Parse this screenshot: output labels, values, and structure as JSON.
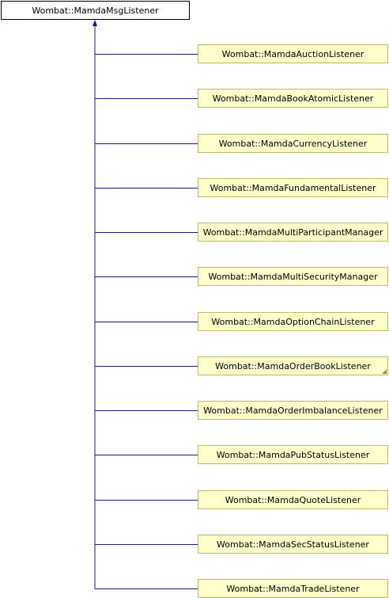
{
  "diagram": {
    "base_class": {
      "label": "Wombat::MamdaMsgListener"
    },
    "derived_classes": [
      {
        "label": "Wombat::MamdaAuctionListener",
        "has_more": false
      },
      {
        "label": "Wombat::MamdaBookAtomicListener",
        "has_more": false
      },
      {
        "label": "Wombat::MamdaCurrencyListener",
        "has_more": false
      },
      {
        "label": "Wombat::MamdaFundamentalListener",
        "has_more": false
      },
      {
        "label": "Wombat::MamdaMultiParticipantManager",
        "has_more": false
      },
      {
        "label": "Wombat::MamdaMultiSecurityManager",
        "has_more": false
      },
      {
        "label": "Wombat::MamdaOptionChainListener",
        "has_more": false
      },
      {
        "label": "Wombat::MamdaOrderBookListener",
        "has_more": true
      },
      {
        "label": "Wombat::MamdaOrderImbalanceListener",
        "has_more": false
      },
      {
        "label": "Wombat::MamdaPubStatusListener",
        "has_more": false
      },
      {
        "label": "Wombat::MamdaQuoteListener",
        "has_more": false
      },
      {
        "label": "Wombat::MamdaSecStatusListener",
        "has_more": false
      },
      {
        "label": "Wombat::MamdaTradeListener",
        "has_more": false
      }
    ],
    "colors": {
      "edge": "#1a1a8c",
      "child_fill": "#ffffcc",
      "child_border": "#c9b567",
      "base_border": "#000000"
    }
  }
}
